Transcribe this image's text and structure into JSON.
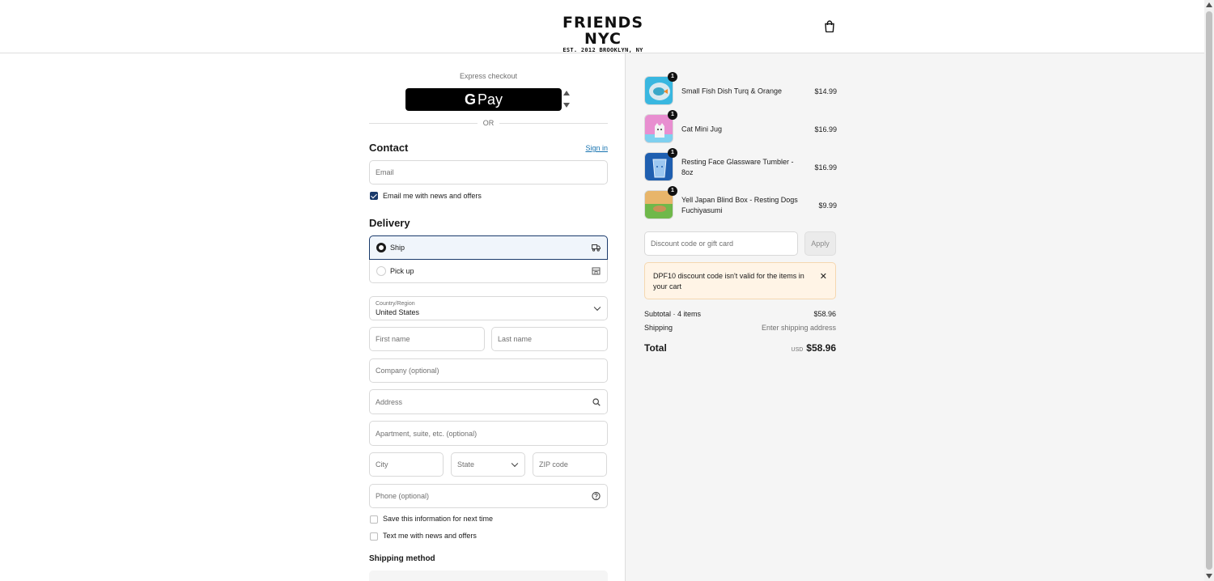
{
  "header": {
    "logo_main": "FRIENDS NYC",
    "logo_sub": "EST. 2012 BROOKLYN, NY",
    "cart_icon": "shopping-bag-icon"
  },
  "express": {
    "label": "Express checkout",
    "gpay_g": "G",
    "gpay_text": "Pay",
    "or_label": "OR"
  },
  "contact": {
    "title": "Contact",
    "signin_label": "Sign in",
    "email_placeholder": "Email",
    "news_label": "Email me with news and offers",
    "news_checked": true
  },
  "delivery": {
    "title": "Delivery",
    "options": [
      {
        "label": "Ship",
        "selected": true,
        "icon": "truck-icon"
      },
      {
        "label": "Pick up",
        "selected": false,
        "icon": "store-icon"
      }
    ],
    "country_label": "Country/Region",
    "country_value": "United States",
    "first_name_placeholder": "First name",
    "last_name_placeholder": "Last name",
    "company_placeholder": "Company (optional)",
    "address_placeholder": "Address",
    "apartment_placeholder": "Apartment, suite, etc. (optional)",
    "city_placeholder": "City",
    "state_placeholder": "State",
    "zip_placeholder": "ZIP code",
    "phone_placeholder": "Phone (optional)",
    "save_info_label": "Save this information for next time",
    "text_me_label": "Text me with news and offers"
  },
  "shipping_method": {
    "title": "Shipping method"
  },
  "summary": {
    "items": [
      {
        "name": "Small Fish Dish Turq & Orange",
        "price": "$14.99",
        "qty": "1",
        "color": "#39b7e0"
      },
      {
        "name": "Cat Mini Jug",
        "price": "$16.99",
        "qty": "1",
        "color": "#e88ed0"
      },
      {
        "name": "Resting Face Glassware Tumbler - 8oz",
        "price": "$16.99",
        "qty": "1",
        "color": "#1f5fb0"
      },
      {
        "name": "Yell Japan Blind Box - Resting Dogs Fuchiyasumi",
        "price": "$9.99",
        "qty": "1",
        "color": "#8fbf5a"
      }
    ],
    "discount_placeholder": "Discount code or gift card",
    "apply_label": "Apply",
    "alert_text": "DPF10 discount code isn't valid for the items in your cart",
    "subtotal_label": "Subtotal · 4 items",
    "subtotal_value": "$58.96",
    "shipping_label": "Shipping",
    "shipping_value": "Enter shipping address",
    "total_label": "Total",
    "total_currency": "USD",
    "total_value": "$58.96"
  }
}
